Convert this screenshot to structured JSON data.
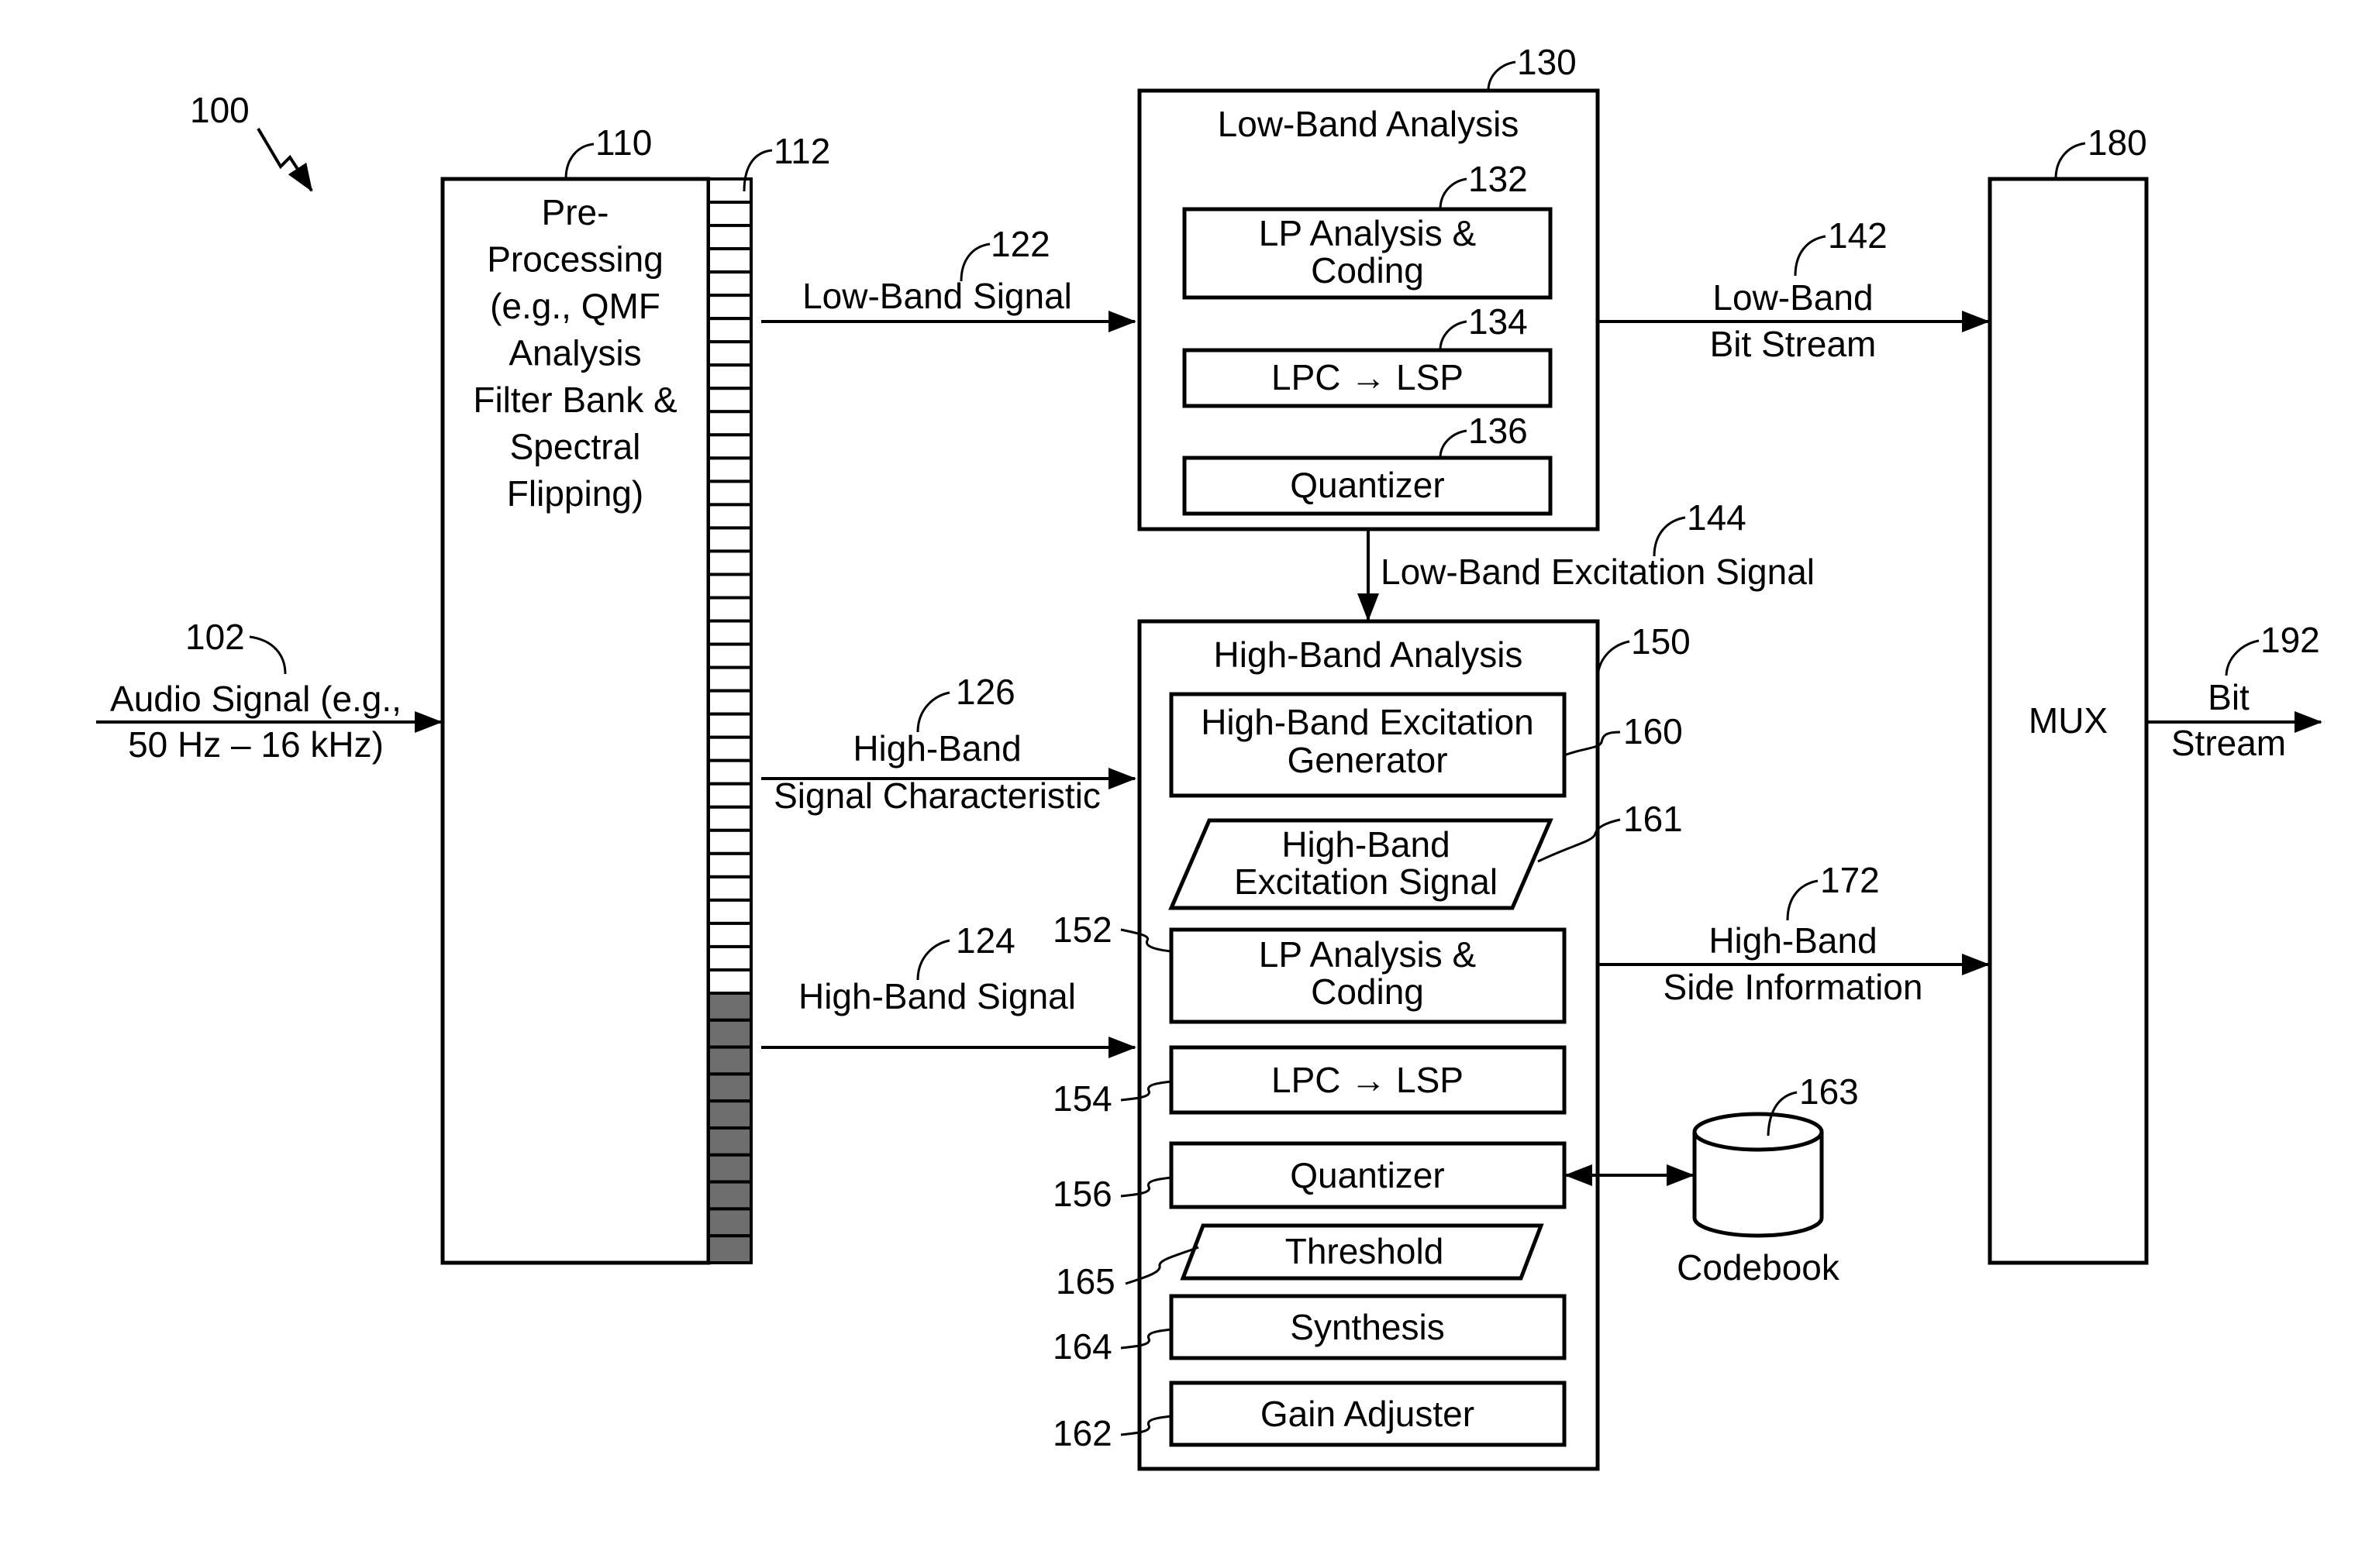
{
  "figure": {
    "ref": "100",
    "input": {
      "ref": "102",
      "label_lines": [
        "Audio Signal (e.g.,",
        "50 Hz – 16 kHz)"
      ]
    },
    "preprocessing": {
      "ref": "110",
      "label_lines": [
        "Pre-",
        "Processing",
        "(e.g., QMF",
        "Analysis",
        "Filter Bank &",
        "Spectral",
        "Flipping)"
      ],
      "filter_bank": {
        "ref": "112",
        "light_cells": 35,
        "dark_cells": 10
      }
    },
    "signals": {
      "low_band_signal": {
        "ref": "122",
        "label_lines": [
          "Low-Band Signal"
        ]
      },
      "high_band_characteristic": {
        "ref": "126",
        "label_lines": [
          "High-Band",
          "Signal Characteristic"
        ]
      },
      "high_band_signal": {
        "ref": "124",
        "label_lines": [
          "High-Band Signal"
        ]
      },
      "low_band_excitation": {
        "ref": "144",
        "label_lines": [
          "Low-Band Excitation Signal"
        ]
      },
      "low_band_bitstream": {
        "ref": "142",
        "label_lines": [
          "Low-Band",
          "Bit Stream"
        ]
      },
      "high_band_side_info": {
        "ref": "172",
        "label_lines": [
          "High-Band",
          "Side Information"
        ]
      },
      "bit_stream": {
        "ref": "192",
        "label_lines": [
          "Bit",
          "Stream"
        ]
      }
    },
    "low_band_analysis": {
      "ref": "130",
      "title": "Low-Band Analysis",
      "blocks": [
        {
          "ref": "132",
          "label_lines": [
            "LP Analysis &",
            "Coding"
          ]
        },
        {
          "ref": "134",
          "label_lines": [
            "LPC → LSP"
          ]
        },
        {
          "ref": "136",
          "label_lines": [
            "Quantizer"
          ]
        }
      ]
    },
    "high_band_analysis": {
      "ref": "150",
      "title": "High-Band Analysis",
      "blocks": [
        {
          "ref": "160",
          "label_lines": [
            "High-Band Excitation",
            "Generator"
          ],
          "shape": "rect"
        },
        {
          "ref": "161",
          "label_lines": [
            "High-Band",
            "Excitation Signal"
          ],
          "shape": "parallelogram"
        },
        {
          "ref": "152",
          "label_lines": [
            "LP Analysis &",
            "Coding"
          ],
          "shape": "rect"
        },
        {
          "ref": "154",
          "label_lines": [
            "LPC → LSP"
          ],
          "shape": "rect"
        },
        {
          "ref": "156",
          "label_lines": [
            "Quantizer"
          ],
          "shape": "rect"
        },
        {
          "ref": "165",
          "label_lines": [
            "Threshold"
          ],
          "shape": "parallelogram"
        },
        {
          "ref": "164",
          "label_lines": [
            "Synthesis"
          ],
          "shape": "rect"
        },
        {
          "ref": "162",
          "label_lines": [
            "Gain Adjuster"
          ],
          "shape": "rect"
        }
      ]
    },
    "codebook": {
      "ref": "163",
      "label": "Codebook"
    },
    "mux": {
      "ref": "180",
      "label": "MUX"
    }
  }
}
